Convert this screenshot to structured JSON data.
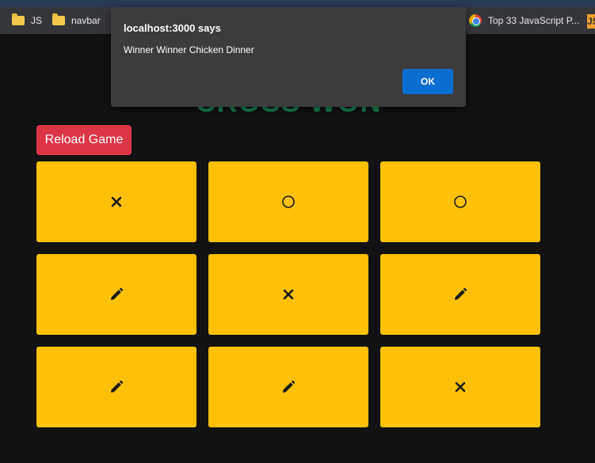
{
  "browser": {
    "bookmarks": [
      {
        "label": "JS",
        "icon": "folder-icon"
      },
      {
        "label": "navbar",
        "icon": "folder-icon"
      },
      {
        "label": "Top 33 JavaScript P...",
        "icon": "chrome-icon"
      }
    ],
    "overflow_label": "JS"
  },
  "game": {
    "title": "CROSS WON",
    "reload_label": "Reload Game",
    "board": [
      "cross",
      "circle",
      "circle",
      "pen",
      "cross",
      "pen",
      "pen",
      "pen",
      "cross"
    ],
    "colors": {
      "background": "#121212",
      "cell": "#ffc107",
      "title": "#198754",
      "reload": "#dc3545"
    }
  },
  "dialog": {
    "title": "localhost:3000 says",
    "message": "Winner Winner Chicken Dinner",
    "ok_label": "OK"
  }
}
